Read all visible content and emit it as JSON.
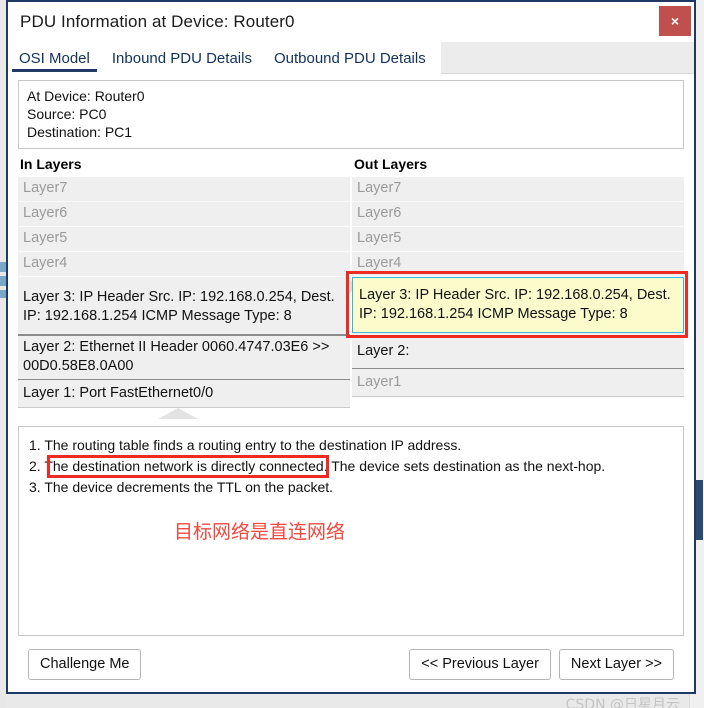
{
  "window": {
    "title": "PDU Information at Device: Router0",
    "close_label": "×",
    "close_icon": "close-icon"
  },
  "tabs": [
    {
      "label": "OSI Model",
      "active": true
    },
    {
      "label": "Inbound PDU Details",
      "active": false
    },
    {
      "label": "Outbound PDU Details",
      "active": false
    }
  ],
  "info": {
    "at_device": "At Device: Router0",
    "source": "Source: PC0",
    "destination": "Destination: PC1"
  },
  "in_layers": {
    "title": "In Layers",
    "rows": [
      {
        "text": "Layer7",
        "state": "dim"
      },
      {
        "text": "Layer6",
        "state": "dim"
      },
      {
        "text": "Layer5",
        "state": "dim"
      },
      {
        "text": "Layer4",
        "state": "dim"
      },
      {
        "text": "Layer 3: IP Header Src. IP: 192.168.0.254, Dest. IP: 192.168.1.254 ICMP Message Type: 8",
        "state": "active"
      },
      {
        "text": "Layer 2: Ethernet II Header 0060.4747.03E6 >> 00D0.58E8.0A00",
        "state": "active"
      },
      {
        "text": "Layer 1: Port FastEthernet0/0",
        "state": "active"
      }
    ]
  },
  "out_layers": {
    "title": "Out Layers",
    "rows": [
      {
        "text": "Layer7",
        "state": "dim"
      },
      {
        "text": "Layer6",
        "state": "dim"
      },
      {
        "text": "Layer5",
        "state": "dim"
      },
      {
        "text": "Layer4",
        "state": "dim"
      },
      {
        "text": "Layer 3: IP Header Src. IP: 192.168.0.254, Dest. IP: 192.168.1.254 ICMP Message Type: 8",
        "state": "highlighted"
      },
      {
        "text": "Layer 2:",
        "state": "active"
      },
      {
        "text": "Layer1",
        "state": "dim"
      }
    ]
  },
  "description": {
    "line1": "1. The routing table finds a routing entry to the destination IP address.",
    "line2": "2. The destination network is directly connected. The device sets destination as the next-hop.",
    "line3": "3. The device decrements the TTL on the packet.",
    "annotation_cn": "目标网络是直连网络"
  },
  "footer": {
    "challenge": "Challenge Me",
    "previous": "<< Previous Layer",
    "next": "Next Layer >>"
  },
  "watermark": "CSDN @日星月云",
  "colors": {
    "accent": "#1f3864",
    "close_button": "#c0504d",
    "highlight_fill": "#fcfbcc",
    "highlight_border": "#36b6d9",
    "annotation_red": "#ee2b22",
    "dim_text": "#9a9a9a"
  }
}
